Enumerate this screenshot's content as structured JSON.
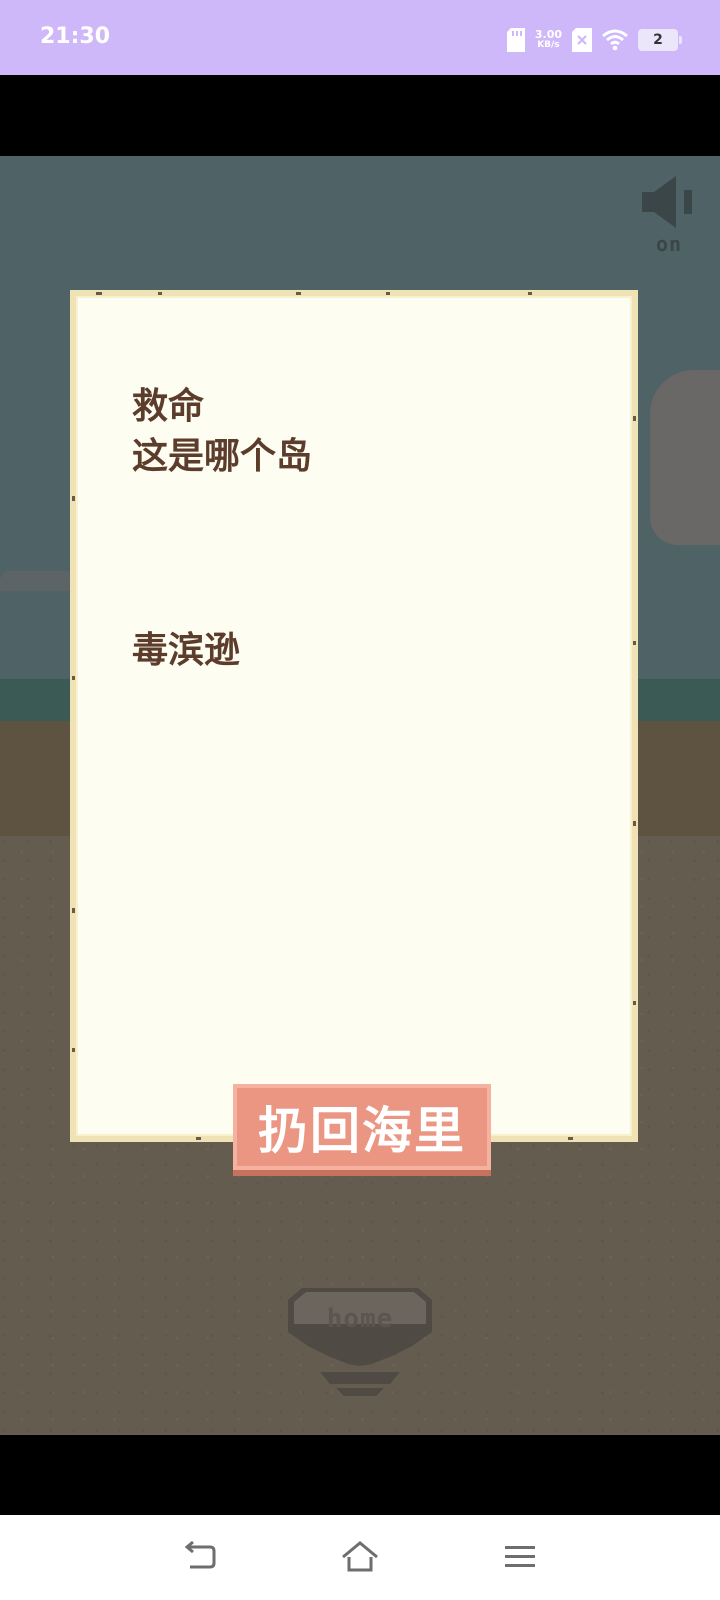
{
  "status_bar": {
    "time": "21:30",
    "net_speed_value": "3.00",
    "net_speed_unit": "KB/s",
    "battery_level": "2",
    "icons": [
      "sd-card-icon",
      "no-sim-icon",
      "wifi-icon",
      "battery-icon"
    ]
  },
  "game": {
    "sound": {
      "label": "on",
      "icon": "speaker-icon",
      "state": "on"
    },
    "note": {
      "lines": [
        "救命",
        "这是哪个岛"
      ],
      "signature": "毒滨逊"
    },
    "throw_button_label": "扔回海里",
    "home_button_label": "home"
  },
  "nav_bar": {
    "icons": [
      "back-icon",
      "home-icon",
      "menu-icon"
    ]
  },
  "colors": {
    "status_bar": "#cfb8fa",
    "sky": "#4f6266",
    "sand": "#655c50",
    "paper": "#fdfdf1",
    "paper_border": "#efe2b4",
    "ink": "#5c3c2b",
    "button": "#eb9682"
  }
}
